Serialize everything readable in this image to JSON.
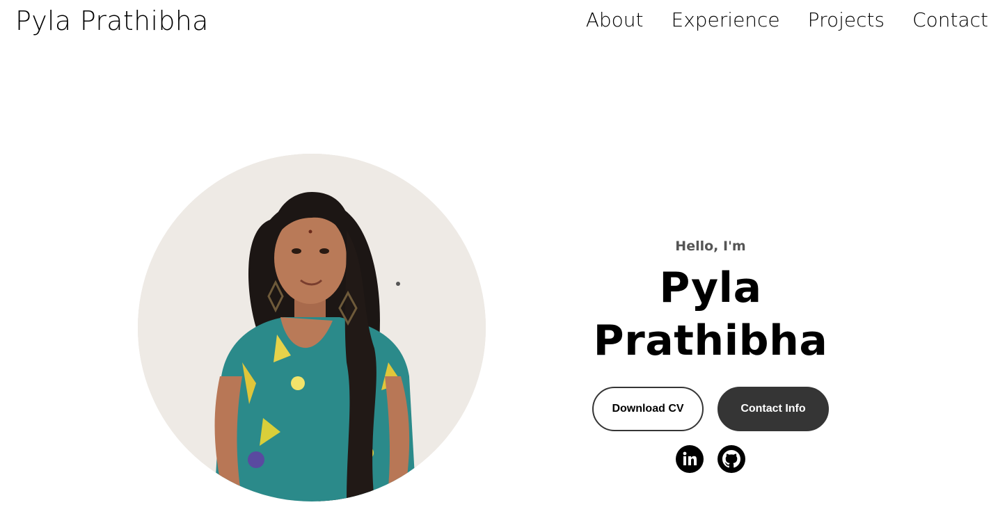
{
  "nav": {
    "logo": "Pyla Prathibha",
    "links": [
      "About",
      "Experience",
      "Projects",
      "Contact"
    ]
  },
  "profile": {
    "image_icon": "profile-photo"
  },
  "hero": {
    "greeting": "Hello, I'm",
    "name": "Pyla Prathibha",
    "buttons": {
      "download_cv": "Download CV",
      "contact_info": "Contact Info"
    },
    "socials": [
      {
        "icon": "linkedin-icon"
      },
      {
        "icon": "github-icon"
      }
    ]
  },
  "colors": {
    "text": "#000000",
    "muted": "#555555",
    "button_dark": "#353535",
    "background": "#ffffff"
  }
}
